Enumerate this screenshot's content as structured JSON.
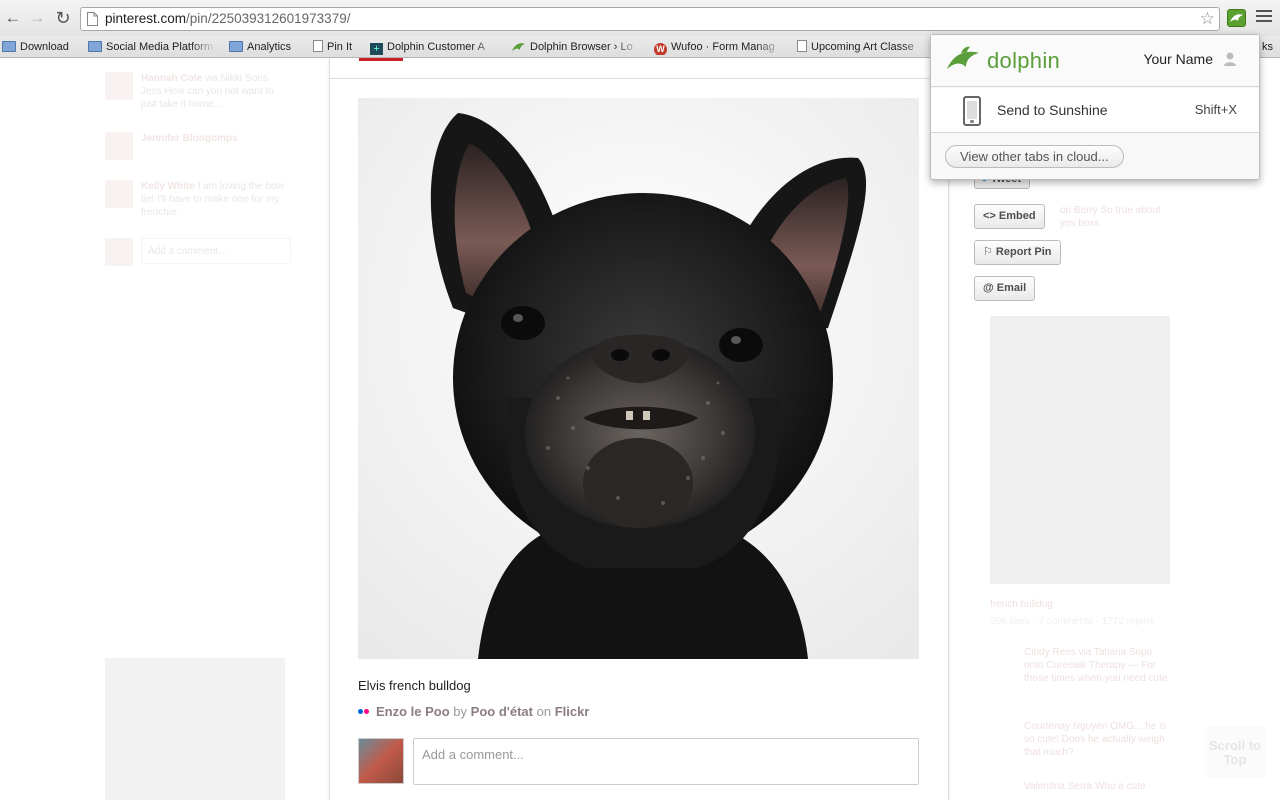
{
  "browser": {
    "url_host": "pinterest.com",
    "url_path": "/pin/225039312601973379/",
    "bookmarks": [
      {
        "label": "Download",
        "icon": "folder-icon"
      },
      {
        "label": "Social Media Platform",
        "icon": "folder-icon"
      },
      {
        "label": "Analytics",
        "icon": "folder-icon"
      },
      {
        "label": "Pin It",
        "icon": "page-icon"
      },
      {
        "label": "Dolphin Customer A",
        "icon": "plus-square-icon"
      },
      {
        "label": "Dolphin Browser › Lo",
        "icon": "dolphin-icon"
      },
      {
        "label": "Wufoo · Form Manag",
        "icon": "wufoo-icon"
      },
      {
        "label": "Upcoming Art Classe",
        "icon": "page-icon"
      }
    ],
    "bookmarks_overflow": "ks"
  },
  "popup": {
    "brand": "dolphin",
    "user_name": "Your Name",
    "send_label": "Send to Sunshine",
    "shortcut": "Shift+X",
    "cloud_button": "View other tabs in cloud..."
  },
  "pin": {
    "caption": "Elvis french bulldog",
    "attribution": {
      "name": "Enzo le Poo",
      "by": "by",
      "author": "Poo d'état",
      "on": "on",
      "source": "Flickr"
    },
    "comment_placeholder": "Add a comment..."
  },
  "actions": {
    "tweet": "Tweet",
    "embed": "<> Embed",
    "report": "⚐ Report Pin",
    "email": "@ Email"
  },
  "ghost": {
    "left_comments": [
      {
        "author": "Hannah Cole",
        "text": "via Nikki Sons Jess How can you not want to just take it home..."
      },
      {
        "author": "Jennifer Blongomps",
        "text": ""
      },
      {
        "author": "Kelly White",
        "text": "I am loving the bow tie! I'll have to make one for my frenchie."
      }
    ],
    "left_input": "Add a comment...",
    "right_texts": [
      "on Berry So true about yes boss",
      "french bulldog",
      "306 likes · 7 comments · 1772 repins",
      "Cindy Rees via Tatiana Sopo onto Cureeaik Therapy — For those times when you need cute",
      "Courtenay Nguyen OMG... he is so cute! Does he actually weigh that much?",
      "Valentina Serra Who a cute"
    ],
    "scroll_top": "Scroll to Top"
  },
  "colors": {
    "dolphin_green": "#5a9e3a",
    "pinterest_red": "#cb2027",
    "attrib_link": "#8c7e7e"
  }
}
